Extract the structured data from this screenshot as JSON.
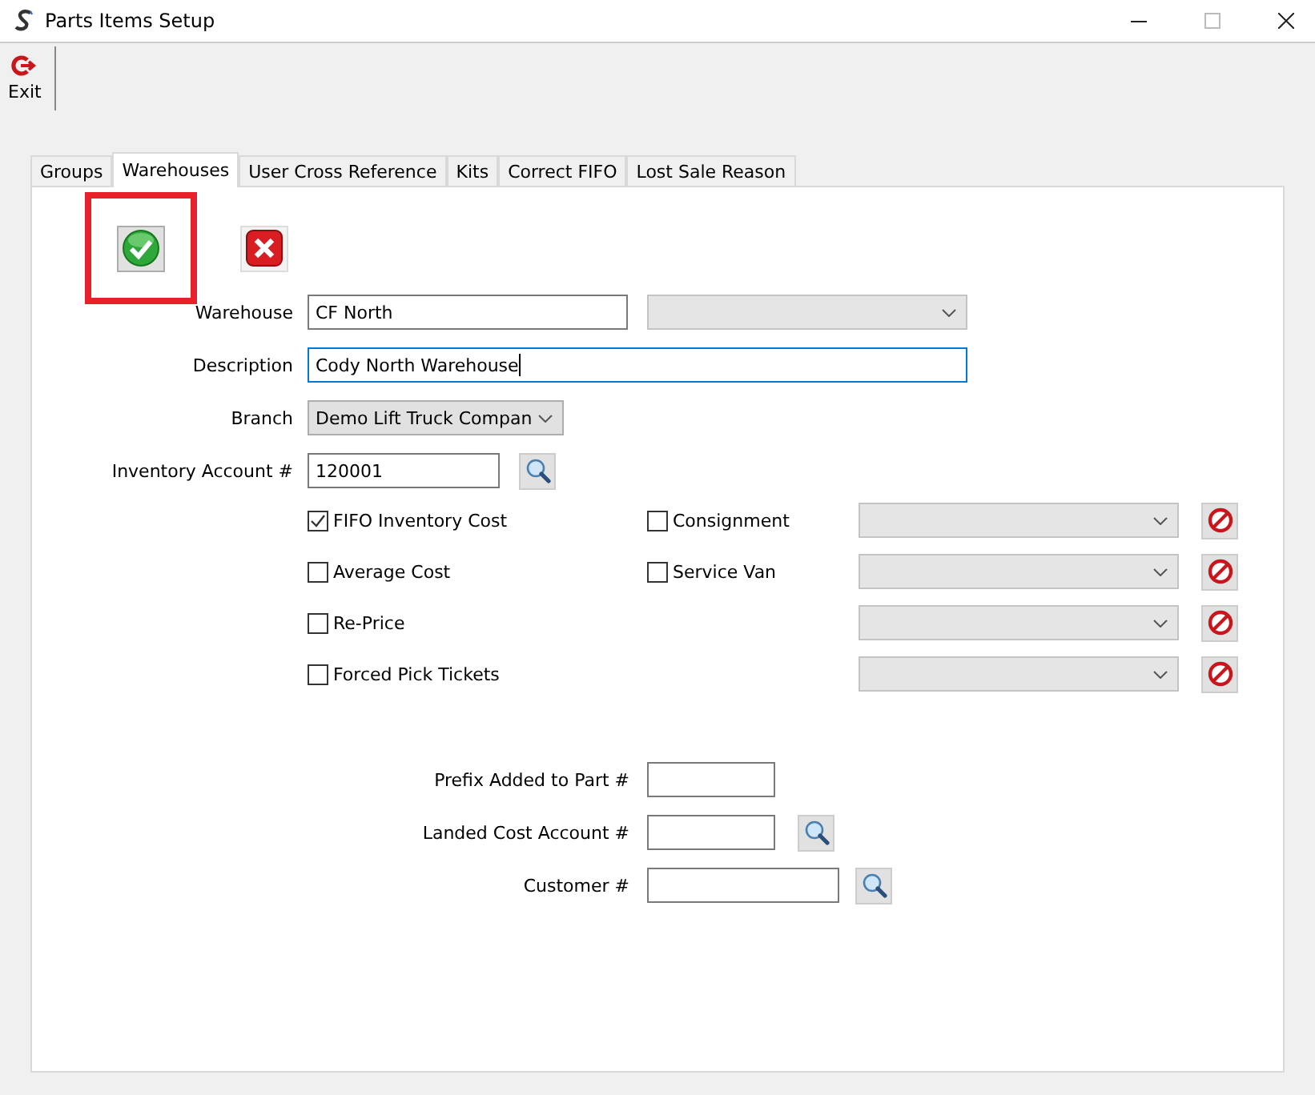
{
  "window": {
    "title": "Parts Items Setup"
  },
  "toolbar": [
    {
      "label": "Exit",
      "kind": "exit"
    }
  ],
  "tabs": [
    {
      "label": "Groups",
      "selected": false
    },
    {
      "label": "Warehouses",
      "selected": true
    },
    {
      "label": "User Cross Reference",
      "selected": false
    },
    {
      "label": "Kits",
      "selected": false
    },
    {
      "label": "Correct FIFO",
      "selected": false
    },
    {
      "label": "Lost Sale Reason",
      "selected": false
    }
  ],
  "action_buttons": [
    {
      "kind": "save",
      "highlighted": true
    },
    {
      "kind": "cancel",
      "highlighted": false
    }
  ],
  "fields": [
    {
      "label": "Warehouse",
      "value": "CF North",
      "kind": "text-with-dropdown",
      "focused": false
    },
    {
      "label": "Description",
      "value": "Cody North Warehouse",
      "kind": "text-wide",
      "focused": true
    },
    {
      "label": "Branch",
      "value": "Demo Lift Truck Compan",
      "kind": "dropdown",
      "focused": false
    },
    {
      "label": "Inventory Account #",
      "value": "120001",
      "kind": "lookup",
      "focused": false
    }
  ],
  "options": [
    {
      "left": {
        "label": "FIFO Inventory Cost",
        "checked": true
      },
      "right": {
        "label": "Consignment",
        "checked": false
      }
    },
    {
      "left": {
        "label": "Average Cost",
        "checked": false
      },
      "right": {
        "label": "Service Van",
        "checked": false
      }
    },
    {
      "left": {
        "label": "Re-Price",
        "checked": false
      }
    },
    {
      "left": {
        "label": "Forced Pick Tickets",
        "checked": false
      }
    }
  ],
  "extra_fields": [
    {
      "label": "Prefix Added to Part #",
      "kind": "text"
    },
    {
      "label": "Landed Cost Account #",
      "kind": "lookup"
    },
    {
      "label": "Customer #",
      "kind": "lookup-wide"
    }
  ]
}
